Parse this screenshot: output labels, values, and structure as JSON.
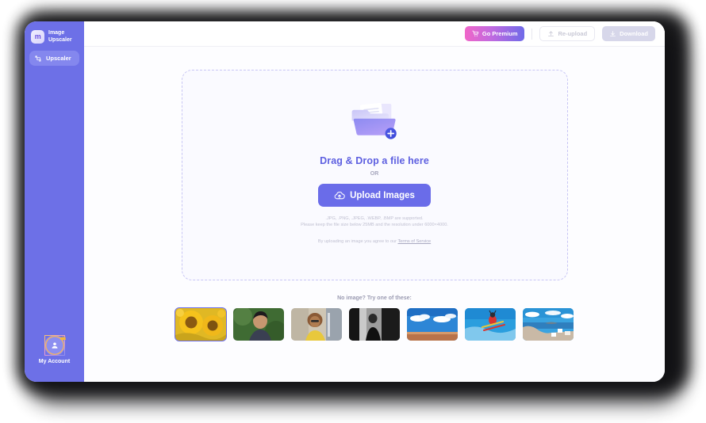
{
  "app": {
    "brand_line1": "Image",
    "brand_line2": "Upscaler",
    "brand_logo_glyph": "m",
    "accent_purple": "#6a6ce9",
    "sidebar_bg": "#6d70e7"
  },
  "sidebar": {
    "items": [
      {
        "label": "Upscaler",
        "icon": "upscale-icon",
        "active": true
      }
    ],
    "account": {
      "label": "My Account",
      "icon": "user-avatar-icon",
      "badge": "crown-badge"
    }
  },
  "header": {
    "buttons": [
      {
        "id": "go-premium",
        "label": "Go Premium",
        "icon": "cart-icon",
        "state": "active"
      },
      {
        "id": "re-upload",
        "label": "Re-upload",
        "icon": "upload-arrow-icon",
        "state": "disabled"
      },
      {
        "id": "download",
        "label": "Download",
        "icon": "download-arrow-icon",
        "state": "disabled"
      }
    ]
  },
  "dropzone": {
    "illustration": "folder-with-documents-plus",
    "title": "Drag & Drop a file here",
    "or": "OR",
    "upload_button_label": "Upload Images",
    "upload_button_icon": "cloud-upload-icon",
    "hint_formats": ".JPG, .PNG, .JPEG, .WEBP, .BMP are supported.",
    "hint_limits": "Please keep the file size below 25MB and the resolution under 6000×4000.",
    "terms_prefix": "By uploading an image you agree to our ",
    "terms_link": "Terms of Service"
  },
  "samples": {
    "title": "No image? Try one of these:",
    "items": [
      {
        "name": "sunflowers",
        "selected": true
      },
      {
        "name": "man-portrait-green",
        "selected": false
      },
      {
        "name": "woman-portrait-street",
        "selected": false
      },
      {
        "name": "black-and-white-person",
        "selected": false
      },
      {
        "name": "desert-sky-clouds",
        "selected": false
      },
      {
        "name": "skier-blue-sky",
        "selected": false
      },
      {
        "name": "coastal-sea-town",
        "selected": false
      }
    ]
  }
}
